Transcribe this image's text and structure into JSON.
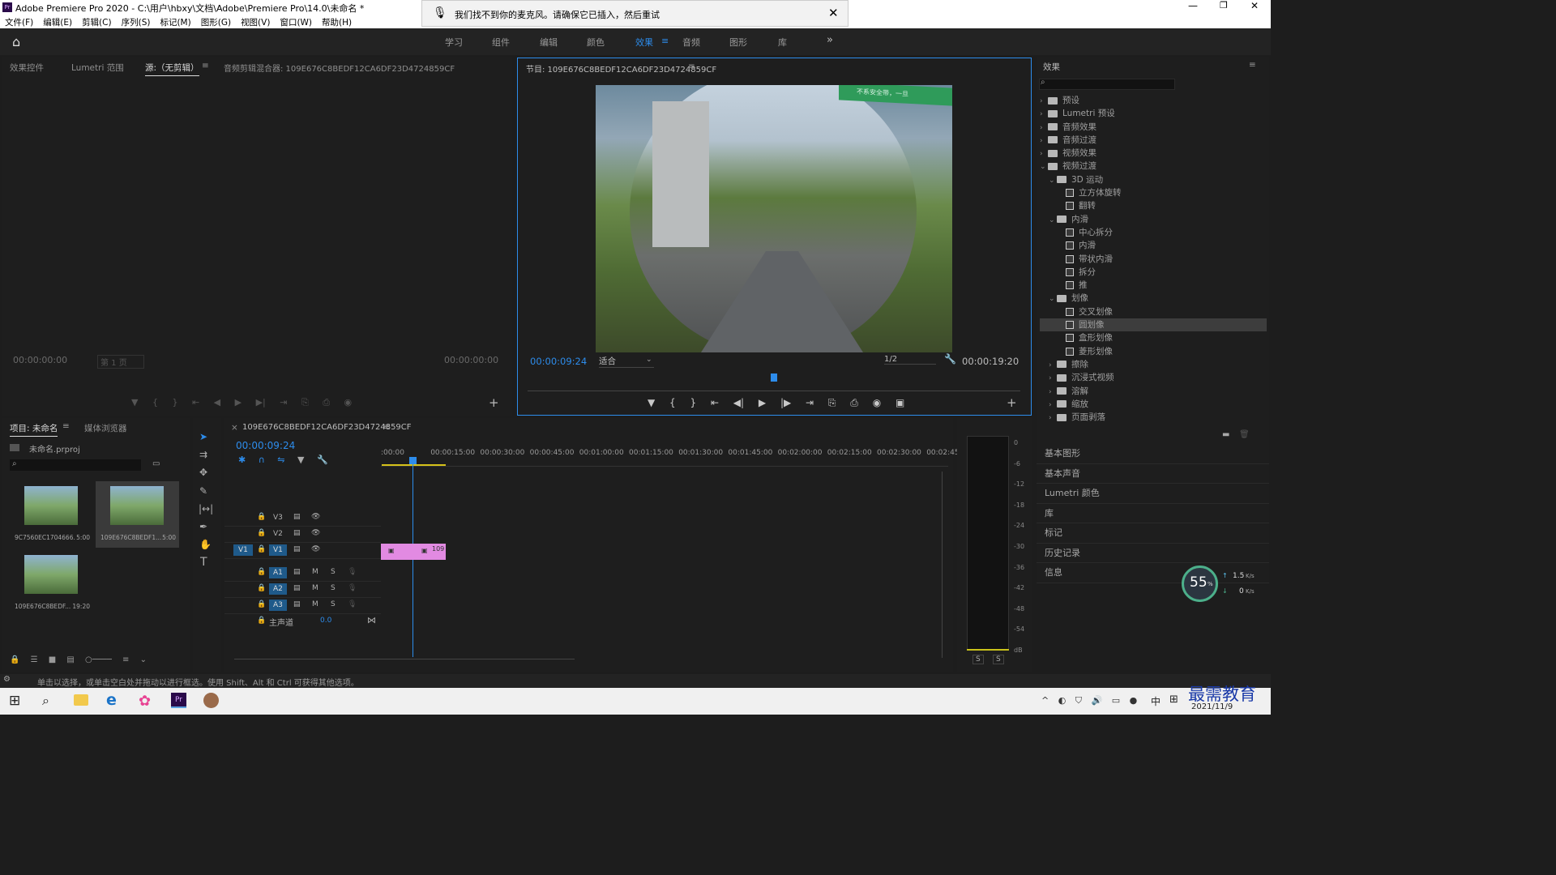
{
  "window": {
    "title": "Adobe Premiere Pro 2020 - C:\\用户\\hbxy\\文档\\Adobe\\Premiere Pro\\14.0\\未命名 *"
  },
  "menu": [
    "文件(F)",
    "编辑(E)",
    "剪辑(C)",
    "序列(S)",
    "标记(M)",
    "图形(G)",
    "视图(V)",
    "窗口(W)",
    "帮助(H)"
  ],
  "notification": {
    "text": "我们找不到你的麦克风。请确保它已插入，然后重试"
  },
  "workspaces": [
    "学习",
    "组件",
    "编辑",
    "颜色",
    "效果",
    "音频",
    "图形",
    "库"
  ],
  "active_workspace": "效果",
  "source_panel": {
    "tabs": [
      "效果控件",
      "Lumetri 范围",
      "源:（无剪辑）",
      "音频剪辑混合器: 109E676C8BEDF12CA6DF23D4724859CF"
    ],
    "timecode_left": "00:00:00:00",
    "timecode_right": "00:00:00:00",
    "page": "第 1 页"
  },
  "program_panel": {
    "title": "节目: 109E676C8BEDF12CA6DF23D4724859CF",
    "timecode": "00:00:09:24",
    "fit": "适合",
    "resolution": "1/2",
    "duration": "00:00:19:20",
    "watermark_text": "不系安全带，一旦"
  },
  "effects_panel": {
    "title": "效果",
    "tree": [
      {
        "label": "预设",
        "type": "folder",
        "level": 0
      },
      {
        "label": "Lumetri 预设",
        "type": "folder",
        "level": 0
      },
      {
        "label": "音频效果",
        "type": "folder",
        "level": 0
      },
      {
        "label": "音频过渡",
        "type": "folder",
        "level": 0
      },
      {
        "label": "视频效果",
        "type": "folder",
        "level": 0
      },
      {
        "label": "视频过渡",
        "type": "folder",
        "level": 0,
        "open": true
      },
      {
        "label": "3D 运动",
        "type": "folder",
        "level": 1,
        "open": true
      },
      {
        "label": "立方体旋转",
        "type": "fx",
        "level": 2
      },
      {
        "label": "翻转",
        "type": "fx",
        "level": 2
      },
      {
        "label": "内滑",
        "type": "folder",
        "level": 1,
        "open": true
      },
      {
        "label": "中心拆分",
        "type": "fx",
        "level": 2
      },
      {
        "label": "内滑",
        "type": "fx",
        "level": 2
      },
      {
        "label": "带状内滑",
        "type": "fx",
        "level": 2
      },
      {
        "label": "拆分",
        "type": "fx",
        "level": 2
      },
      {
        "label": "推",
        "type": "fx",
        "level": 2
      },
      {
        "label": "划像",
        "type": "folder",
        "level": 1,
        "open": true
      },
      {
        "label": "交叉划像",
        "type": "fx",
        "level": 2
      },
      {
        "label": "圆划像",
        "type": "fx",
        "level": 2,
        "selected": true
      },
      {
        "label": "盒形划像",
        "type": "fx",
        "level": 2
      },
      {
        "label": "菱形划像",
        "type": "fx",
        "level": 2
      },
      {
        "label": "擦除",
        "type": "folder",
        "level": 1
      },
      {
        "label": "沉浸式视频",
        "type": "folder",
        "level": 1
      },
      {
        "label": "溶解",
        "type": "folder",
        "level": 1
      },
      {
        "label": "缩放",
        "type": "folder",
        "level": 1
      },
      {
        "label": "页面剥落",
        "type": "folder",
        "level": 1
      }
    ]
  },
  "side_panels": [
    "基本图形",
    "基本声音",
    "Lumetri 颜色",
    "库",
    "标记",
    "历史记录",
    "信息"
  ],
  "project_panel": {
    "tabs": [
      "项目: 未命名",
      "媒体浏览器"
    ],
    "project_file": "未命名.prproj",
    "items": [
      {
        "name": "9C7560EC1704666...",
        "duration": "5:00"
      },
      {
        "name": "109E676C8BEDF1...",
        "duration": "5:00"
      },
      {
        "name": "109E676C8BEDF...",
        "duration": "19:20"
      }
    ]
  },
  "timeline": {
    "sequence": "109E676C8BEDF12CA6DF23D4724859CF",
    "timecode": "00:00:09:24",
    "ruler": [
      ":00:00",
      "00:00:15:00",
      "00:00:30:00",
      "00:00:45:00",
      "00:01:00:00",
      "00:01:15:00",
      "00:01:30:00",
      "00:01:45:00",
      "00:02:00:00",
      "00:02:15:00",
      "00:02:30:00",
      "00:02:45:0"
    ],
    "video_tracks": [
      "V3",
      "V2",
      "V1"
    ],
    "audio_tracks": [
      "A1",
      "A2",
      "A3"
    ],
    "master": "主声道",
    "master_value": "0.0",
    "clip_label": "109",
    "source_patch": "V1"
  },
  "meter": {
    "scale": [
      "0",
      "-6",
      "-12",
      "-18",
      "-24",
      "-30",
      "-36",
      "-42",
      "-48",
      "-54",
      "dB"
    ],
    "solo": [
      "S",
      "S"
    ]
  },
  "net_widget": {
    "percent": "55",
    "unit": "%",
    "up": "1.5",
    "up_unit": "K/s",
    "down": "0",
    "down_unit": "K/s"
  },
  "status_bar": "单击以选择，或单击空白处并拖动以进行框选。使用 Shift、Alt 和 Ctrl 可获得其他选项。",
  "taskbar": {
    "ime": "中",
    "date": "2021/11/9",
    "brand": "最需教育"
  }
}
